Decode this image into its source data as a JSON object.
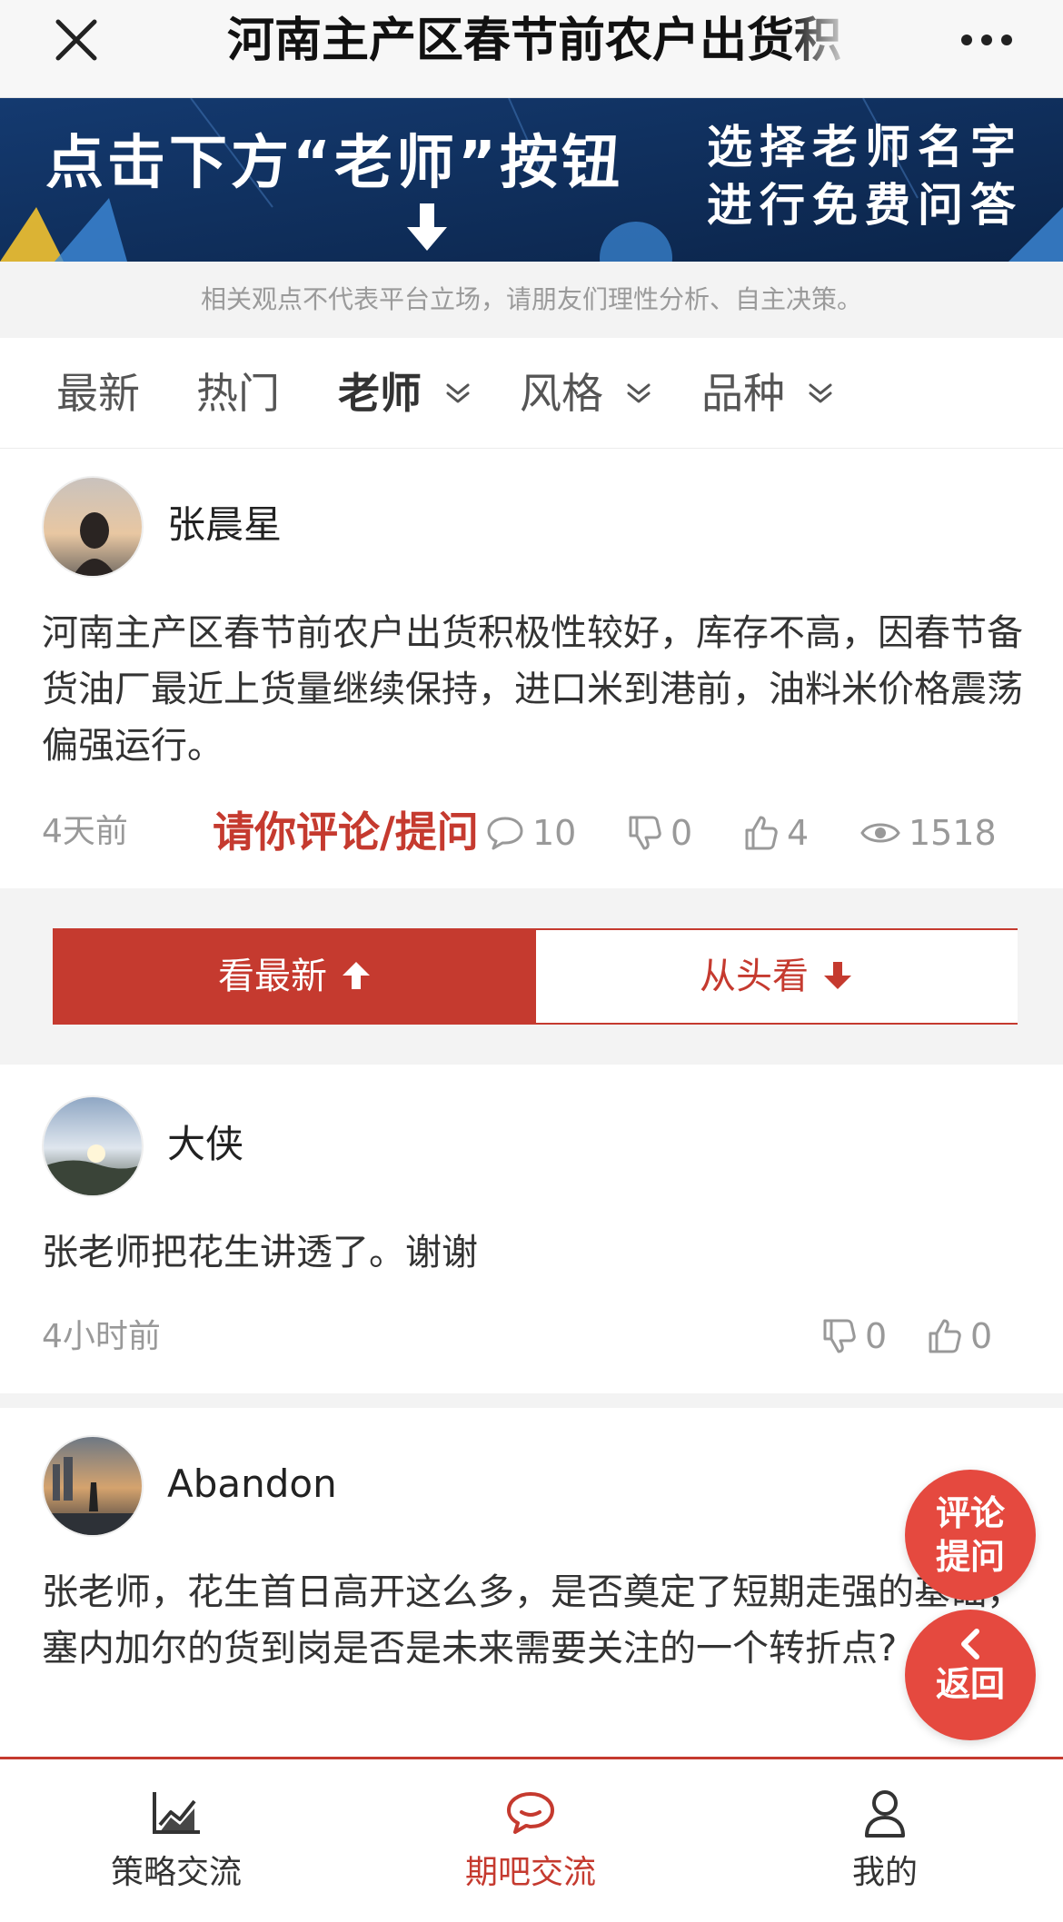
{
  "topbar": {
    "title": "河南主产区春节前农户出货积",
    "close_icon": "close-icon",
    "more_icon": "more-icon"
  },
  "banner": {
    "left_text": "点击下方“老师”按钮",
    "right_line1": "选择老师名字",
    "right_line2": "进行免费问答",
    "arrow_icon": "arrow-down-icon",
    "colors": {
      "background": "#0f2e5b",
      "text": "#ffffff"
    }
  },
  "disclaimer": "相关观点不代表平台立场，请朋友们理性分析、自主决策。",
  "tabs": [
    {
      "label": "最新",
      "has_dropdown": false,
      "active": false
    },
    {
      "label": "热门",
      "has_dropdown": false,
      "active": false
    },
    {
      "label": "老师",
      "has_dropdown": true,
      "active": true
    },
    {
      "label": "风格",
      "has_dropdown": true,
      "active": false
    },
    {
      "label": "品种",
      "has_dropdown": true,
      "active": false
    }
  ],
  "post": {
    "author": "张晨星",
    "content": "河南主产区春节前农户出货积极性较好，库存不高，因春节备货油厂最近上货量继续保持，进口米到港前，油料米价格震荡偏强运行。",
    "time": "4天前",
    "cta": "请你评论/提问",
    "comments": "10",
    "dislikes": "0",
    "likes": "4",
    "views": "1518"
  },
  "sort": {
    "latest": "看最新",
    "from_start": "从头看"
  },
  "comments": [
    {
      "author": "大侠",
      "content": "张老师把花生讲透了。谢谢",
      "time": "4小时前",
      "dislikes": "0",
      "likes": "0"
    },
    {
      "author": "Abandon",
      "content": "张老师，花生首日高开这么多，是否奠定了短期走强的基础，塞内加尔的货到岗是否是未来需要关注的一个转折点?"
    }
  ],
  "fab": {
    "comment_line1": "评论",
    "comment_line2": "提问",
    "back_label": "返回"
  },
  "bottom_nav": [
    {
      "label": "策略交流",
      "icon": "trend-chart-icon",
      "active": false
    },
    {
      "label": "期吧交流",
      "icon": "chat-bubble-icon",
      "active": true
    },
    {
      "label": "我的",
      "icon": "user-icon",
      "active": false
    }
  ],
  "colors": {
    "accent": "#c53a2f",
    "fab": "#e5493f",
    "muted": "#999999"
  }
}
